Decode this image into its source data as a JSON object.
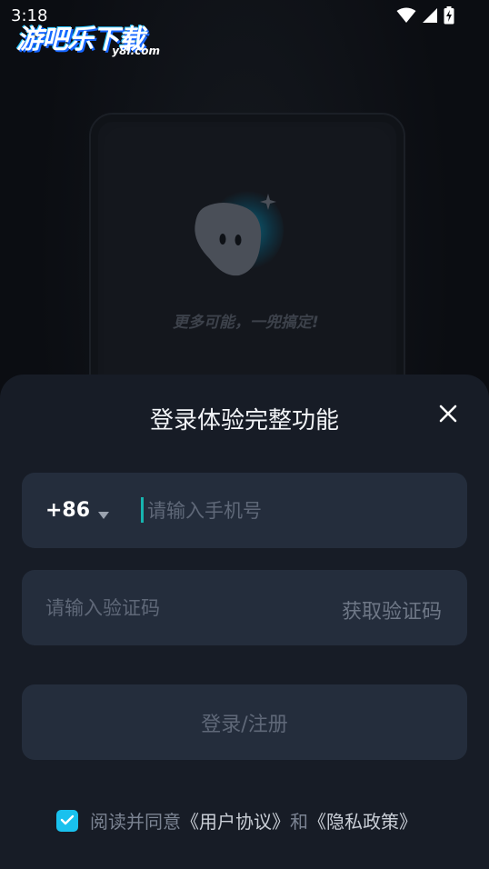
{
  "status_bar": {
    "time": "3:18",
    "icons": [
      "wifi-icon",
      "signal-icon",
      "battery-charging-icon"
    ]
  },
  "watermark": {
    "main": "游吧乐下载",
    "sub": "y8l.com"
  },
  "preview": {
    "slogan": "更多可能，一兜搞定!"
  },
  "login_sheet": {
    "title": "登录体验完整功能",
    "close_icon": "close-icon",
    "country_code": "+86",
    "phone_placeholder": "请输入手机号",
    "phone_value": "",
    "code_placeholder": "请输入验证码",
    "code_value": "",
    "get_code_label": "获取验证码",
    "login_button_label": "登录/注册",
    "agreement": {
      "checked": true,
      "prefix": "阅读并同意",
      "user_agreement": "《用户协议》",
      "conjunction": "和",
      "privacy_policy": "《隐私政策》"
    }
  },
  "colors": {
    "background": "#0b0d12",
    "sheet": "#171c26",
    "field": "#242d3c",
    "accent": "#19c1ee",
    "cursor": "#17b5b0"
  }
}
